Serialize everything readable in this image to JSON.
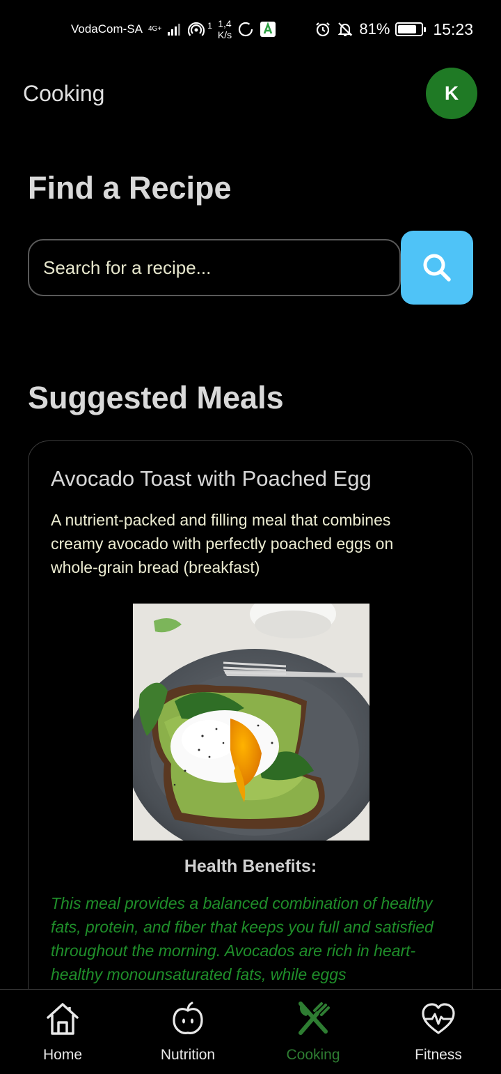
{
  "status_bar": {
    "carrier": "VodaCom-SA",
    "network": "4G+",
    "hotspot_count": "1",
    "speed_value": "1,4",
    "speed_unit": "K/s",
    "battery_percent": "81%",
    "battery_level": 0.81,
    "time": "15:23"
  },
  "header": {
    "title": "Cooking",
    "avatar_initial": "K",
    "avatar_color": "#1f7a25"
  },
  "find_section": {
    "title": "Find a Recipe",
    "search_placeholder": "Search for a recipe...",
    "search_button_color": "#4fc3f7",
    "search_icon": "search-icon"
  },
  "suggested_section": {
    "title": "Suggested Meals"
  },
  "meal_card": {
    "title": "Avocado Toast with Poached Egg",
    "description": "A nutrient-packed and filling meal that combines creamy avocado with perfectly poached eggs on whole-grain bread (breakfast)",
    "image_subject": "avocado toast with poached egg",
    "benefits_heading": "Health Benefits:",
    "benefits_text": "This meal provides a balanced combination of healthy fats, protein, and fiber that keeps you full and satisfied throughout the morning. Avocados are rich in heart-healthy monounsaturated fats, while eggs",
    "benefits_color": "#1f8f2a"
  },
  "bottom_nav": {
    "active_color": "#2e7d32",
    "items": [
      {
        "label": "Home",
        "icon": "home-icon",
        "active": false
      },
      {
        "label": "Nutrition",
        "icon": "apple-icon",
        "active": false
      },
      {
        "label": "Cooking",
        "icon": "fork-knife-icon",
        "active": true
      },
      {
        "label": "Fitness",
        "icon": "heart-pulse-icon",
        "active": false
      }
    ]
  }
}
